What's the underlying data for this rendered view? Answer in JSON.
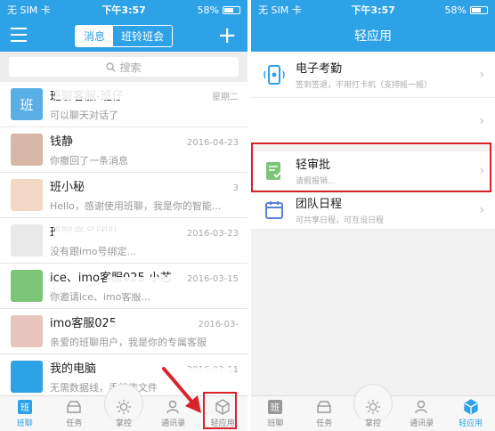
{
  "status": {
    "carrier": "无 SIM 卡",
    "time": "下午3:57",
    "battery": "58%"
  },
  "left": {
    "segment": {
      "tab_messages": "消息",
      "tab_class": "班铃班会"
    },
    "search": {
      "placeholder": "搜索"
    },
    "chats": [
      {
        "name": "班聊客服-班仔",
        "time": "星期二",
        "message": "可以聊天对话了",
        "avatar_char": "班",
        "avatar_color": "#5aaee6"
      },
      {
        "name": "钱静",
        "time": "2016-04-23",
        "message": "你撤回了一条消息",
        "avatar_char": "",
        "avatar_color": "#d7b7a6"
      },
      {
        "name": "班小秘",
        "time": "3",
        "message": "Hello，感谢使用班聊，我是你的智能...",
        "avatar_char": "",
        "avatar_color": "#f3d8c6"
      },
      {
        "name": "班聊产品团队",
        "time": "2016-03-23",
        "message": "没有跟imo号绑定...",
        "avatar_char": "",
        "avatar_color": "#e9e9e9"
      },
      {
        "name": "ice、imo客服025 小芯",
        "time": "2016-03-15",
        "message": "你邀请ice、imo客服...",
        "avatar_char": "",
        "avatar_color": "#7cc576"
      },
      {
        "name": "imo客服025",
        "time": "2016-03-",
        "message": "亲爱的班聊用户，我是你的专属客服",
        "avatar_char": "",
        "avatar_color": "#e7c4bd"
      },
      {
        "name": "我的电脑",
        "time": "2016-03-11",
        "message": "无需数据线，手机传文件",
        "avatar_char": "",
        "avatar_color": "#2ea2e6"
      }
    ],
    "tabs": [
      {
        "label": "班聊",
        "icon": "chat-icon"
      },
      {
        "label": "任务",
        "icon": "task-icon"
      },
      {
        "label": "掌控",
        "icon": "control-icon"
      },
      {
        "label": "通讯录",
        "icon": "contacts-icon"
      },
      {
        "label": "轻应用",
        "icon": "apps-icon"
      }
    ],
    "active_tab": 0
  },
  "right": {
    "title": "轻应用",
    "apps": [
      {
        "name": "电子考勤",
        "desc": "签到签退，不用打卡机（支持摇一摇）",
        "icon": "attendance-icon"
      },
      {
        "name": "",
        "desc": "",
        "icon": ""
      },
      {
        "name": "轻审批",
        "desc": "请假报销...",
        "icon": "approval-icon"
      },
      {
        "name": "团队日程",
        "desc": "可共享日程，可互设日程",
        "icon": "calendar-icon"
      }
    ],
    "tabs": [
      {
        "label": "班聊",
        "icon": "chat-icon"
      },
      {
        "label": "任务",
        "icon": "task-icon"
      },
      {
        "label": "掌控",
        "icon": "control-icon"
      },
      {
        "label": "通讯录",
        "icon": "contacts-icon"
      },
      {
        "label": "轻应用",
        "icon": "apps-icon"
      }
    ],
    "active_tab": 4
  },
  "colors": {
    "primary": "#2ea2e6",
    "highlight": "#d8232a"
  }
}
